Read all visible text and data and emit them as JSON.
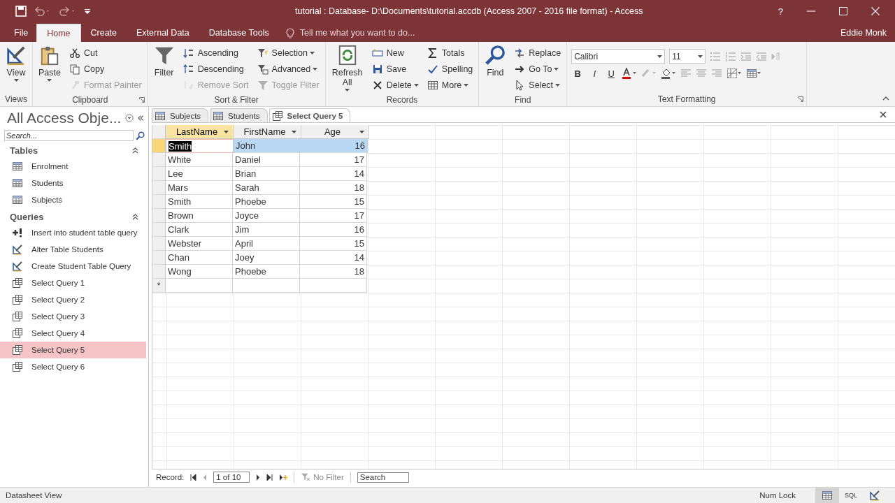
{
  "window": {
    "title": "tutorial : Database- D:\\Documents\\tutorial.accdb (Access 2007 - 2016 file format) - Access",
    "help": "?"
  },
  "ribbon_tabs": [
    {
      "label": "File",
      "selected": false
    },
    {
      "label": "Home",
      "selected": true
    },
    {
      "label": "Create",
      "selected": false
    },
    {
      "label": "External Data",
      "selected": false
    },
    {
      "label": "Database Tools",
      "selected": false
    }
  ],
  "tell_me": {
    "placeholder": "Tell me what you want to do..."
  },
  "user": "Eddie Monk",
  "ribbon_groups": [
    {
      "label": "Views",
      "kind": "buttons",
      "launcher": false,
      "columns": [
        {
          "kind": "large",
          "buttons": [
            {
              "label": "View",
              "dropdown": true,
              "disabled": false
            }
          ]
        }
      ]
    },
    {
      "label": "Clipboard",
      "kind": "buttons",
      "launcher": true,
      "columns": [
        {
          "kind": "large",
          "buttons": [
            {
              "label": "Paste",
              "dropdown": true,
              "disabled": false
            }
          ]
        },
        {
          "kind": "small",
          "buttons": [
            {
              "label": "Cut",
              "dropdown": false,
              "disabled": false
            },
            {
              "label": "Copy",
              "dropdown": false,
              "disabled": false
            },
            {
              "label": "Format Painter",
              "dropdown": false,
              "disabled": true
            }
          ]
        }
      ]
    },
    {
      "label": "Sort & Filter",
      "kind": "buttons",
      "launcher": false,
      "columns": [
        {
          "kind": "large",
          "buttons": [
            {
              "label": "Filter",
              "dropdown": false,
              "disabled": false
            }
          ]
        },
        {
          "kind": "small",
          "buttons": [
            {
              "label": "Ascending",
              "dropdown": false,
              "disabled": false
            },
            {
              "label": "Descending",
              "dropdown": false,
              "disabled": false
            },
            {
              "label": "Remove Sort",
              "dropdown": false,
              "disabled": true
            }
          ]
        },
        {
          "kind": "small",
          "buttons": [
            {
              "label": "Selection",
              "dropdown": true,
              "disabled": false
            },
            {
              "label": "Advanced",
              "dropdown": true,
              "disabled": false
            },
            {
              "label": "Toggle Filter",
              "dropdown": false,
              "disabled": true
            }
          ]
        }
      ]
    },
    {
      "label": "Records",
      "kind": "buttons",
      "launcher": false,
      "columns": [
        {
          "kind": "large",
          "buttons": [
            {
              "label": "Refresh All",
              "dropdown": true,
              "disabled": false
            }
          ]
        },
        {
          "kind": "small",
          "buttons": [
            {
              "label": "New",
              "dropdown": false,
              "disabled": false
            },
            {
              "label": "Save",
              "dropdown": false,
              "disabled": false
            },
            {
              "label": "Delete",
              "dropdown": true,
              "disabled": false
            }
          ]
        },
        {
          "kind": "small",
          "buttons": [
            {
              "label": "Totals",
              "dropdown": false,
              "disabled": false
            },
            {
              "label": "Spelling",
              "dropdown": false,
              "disabled": false
            },
            {
              "label": "More",
              "dropdown": true,
              "disabled": false
            }
          ]
        }
      ]
    },
    {
      "label": "Find",
      "kind": "buttons",
      "launcher": false,
      "columns": [
        {
          "kind": "large",
          "buttons": [
            {
              "label": "Find",
              "dropdown": false,
              "disabled": false
            }
          ]
        },
        {
          "kind": "small",
          "buttons": [
            {
              "label": "Replace",
              "dropdown": false,
              "disabled": false
            },
            {
              "label": "Go To",
              "dropdown": true,
              "disabled": false
            },
            {
              "label": "Select",
              "dropdown": true,
              "disabled": false
            }
          ]
        }
      ]
    },
    {
      "label": "Text Formatting",
      "kind": "format",
      "launcher": true,
      "font": "Calibri",
      "size": "11",
      "styles": [
        "B",
        "I",
        "U"
      ]
    }
  ],
  "nav_pane": {
    "title": "All Access Obje...",
    "search": {
      "placeholder": "Search..."
    },
    "sections": [
      {
        "title": "Tables",
        "expanded": true,
        "items": [
          {
            "label": "Enrolment",
            "kind": "table",
            "selected": false
          },
          {
            "label": "Students",
            "kind": "table",
            "selected": false
          },
          {
            "label": "Subjects",
            "kind": "table",
            "selected": false
          }
        ]
      },
      {
        "title": "Queries",
        "expanded": true,
        "items": [
          {
            "label": "Insert into student table query",
            "kind": "append",
            "selected": false
          },
          {
            "label": "Alter Table Students",
            "kind": "ddl",
            "selected": false
          },
          {
            "label": "Create Student Table Query",
            "kind": "ddl",
            "selected": false
          },
          {
            "label": "Select Query 1",
            "kind": "query",
            "selected": false
          },
          {
            "label": "Select Query 2",
            "kind": "query",
            "selected": false
          },
          {
            "label": "Select Query 3",
            "kind": "query",
            "selected": false
          },
          {
            "label": "Select Query 4",
            "kind": "query",
            "selected": false
          },
          {
            "label": "Select Query 5",
            "kind": "query",
            "selected": true
          },
          {
            "label": "Select Query 6",
            "kind": "query",
            "selected": false
          }
        ]
      }
    ]
  },
  "document_tabs": [
    {
      "label": "Subjects",
      "kind": "table",
      "selected": false
    },
    {
      "label": "Students",
      "kind": "table",
      "selected": false
    },
    {
      "label": "Select Query 5",
      "kind": "query",
      "selected": true
    }
  ],
  "datasheet": {
    "columns": [
      {
        "label": "LastName",
        "kind": "text",
        "selected": true
      },
      {
        "label": "FirstName",
        "kind": "text",
        "selected": false
      },
      {
        "label": "Age",
        "kind": "number",
        "selected": false
      }
    ],
    "rows": [
      {
        "cells": [
          "Smith",
          "John",
          "16"
        ],
        "selected": true
      },
      {
        "cells": [
          "White",
          "Daniel",
          "17"
        ],
        "selected": false
      },
      {
        "cells": [
          "Lee",
          "Brian",
          "14"
        ],
        "selected": false
      },
      {
        "cells": [
          "Mars",
          "Sarah",
          "18"
        ],
        "selected": false
      },
      {
        "cells": [
          "Smith",
          "Phoebe",
          "15"
        ],
        "selected": false
      },
      {
        "cells": [
          "Brown",
          "Joyce",
          "17"
        ],
        "selected": false
      },
      {
        "cells": [
          "Clark",
          "Jim",
          "16"
        ],
        "selected": false
      },
      {
        "cells": [
          "Webster",
          "April",
          "15"
        ],
        "selected": false
      },
      {
        "cells": [
          "Chan",
          "Joey",
          "14"
        ],
        "selected": false
      },
      {
        "cells": [
          "Wong",
          "Phoebe",
          "18"
        ],
        "selected": false
      }
    ],
    "new_row_marker": "*"
  },
  "record_nav": {
    "label": "Record:",
    "position": "1 of 10",
    "filter": "No Filter",
    "search": {
      "placeholder": "Search"
    }
  },
  "status_bar": {
    "view": "Datasheet View",
    "num_lock": "Num Lock",
    "views": [
      {
        "kind": "datasheet",
        "selected": true
      },
      {
        "kind": "sql",
        "label": "SQL",
        "selected": false
      },
      {
        "kind": "design",
        "selected": false
      }
    ]
  }
}
